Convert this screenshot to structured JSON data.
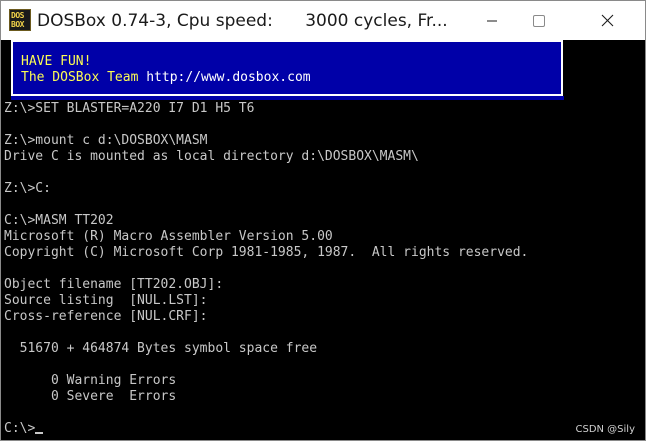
{
  "window": {
    "title": "DOSBox 0.74-3, Cpu speed:      3000 cycles, Fr...",
    "icon_lines": [
      "DOS",
      "BOX"
    ],
    "icon": "dosbox-app-icon"
  },
  "controls": {
    "minimize_icon": "minimize-icon",
    "maximize_icon": "maximize-icon",
    "close_icon": "close-icon"
  },
  "banner": {
    "line1": "HAVE FUN!",
    "line2_prefix": "The DOSBox Team ",
    "line2_url": "http://www.dosbox.com",
    "bg_color": "#0000a8",
    "text_color": "#fcfc54"
  },
  "terminal": {
    "lines": [
      "Z:\\>SET BLASTER=A220 I7 D1 H5 T6",
      "",
      "Z:\\>mount c d:\\DOSBOX\\MASM",
      "Drive C is mounted as local directory d:\\DOSBOX\\MASM\\",
      "",
      "Z:\\>C:",
      "",
      "C:\\>MASM TT202",
      "Microsoft (R) Macro Assembler Version 5.00",
      "Copyright (C) Microsoft Corp 1981-1985, 1987.  All rights reserved.",
      "",
      "Object filename [TT202.OBJ]:",
      "Source listing  [NUL.LST]:",
      "Cross-reference [NUL.CRF]:",
      "",
      "  51670 + 464874 Bytes symbol space free",
      "",
      "      0 Warning Errors",
      "      0 Severe  Errors",
      "",
      "C:\\>"
    ],
    "text_color": "#c8c8c8"
  },
  "watermark": "CSDN @Sily"
}
